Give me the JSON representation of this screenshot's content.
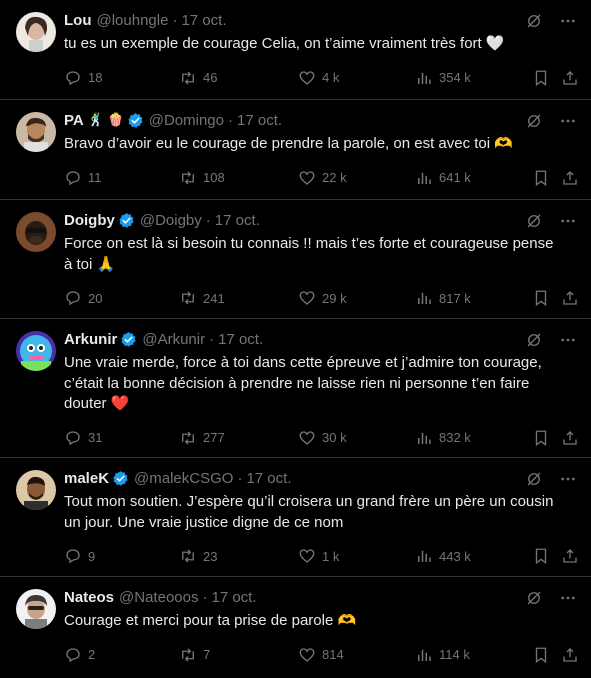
{
  "colors": {
    "background": "#000000",
    "text": "#e7e9ea",
    "muted": "#71767b",
    "verified": "#1d9bf0",
    "divider": "#2f3336"
  },
  "tweets": [
    {
      "name": "Lou",
      "name_emojis": "",
      "verified": false,
      "handle": "@louhngle",
      "dot": "·",
      "date": "17 oct.",
      "text": "tu es un exemple de courage Celia, on t’aime vraiment très fort 🤍",
      "replies": "18",
      "retweets": "46",
      "likes": "4 k",
      "views": "354 k",
      "avatar_color": "#c7b8ad"
    },
    {
      "name": "PA",
      "name_emojis": "🕺 🍿",
      "verified": true,
      "handle": "@Domingo",
      "dot": "·",
      "date": "17 oct.",
      "text": "Bravo d’avoir eu le courage de prendre la parole, on est avec toi 🫶",
      "replies": "11",
      "retweets": "108",
      "likes": "22 k",
      "views": "641 k",
      "avatar_color": "#8a6b4d"
    },
    {
      "name": "Doigby",
      "name_emojis": "",
      "verified": true,
      "handle": "@Doigby",
      "dot": "·",
      "date": "17 oct.",
      "text": "Force on est là si besoin tu connais !!  mais t’es forte et courageuse pense à toi 🙏",
      "replies": "20",
      "retweets": "241",
      "likes": "29 k",
      "views": "817 k",
      "avatar_color": "#5a3a2a"
    },
    {
      "name": "Arkunir",
      "name_emojis": "",
      "verified": true,
      "handle": "@Arkunir",
      "dot": "·",
      "date": "17 oct.",
      "text": "Une vraie merde, force à toi dans cette épreuve et j’admire ton courage, c’était la bonne décision à prendre ne laisse rien ni personne t’en faire douter ❤️",
      "replies": "31",
      "retweets": "277",
      "likes": "30 k",
      "views": "832 k",
      "avatar_color": "#6f4fd8"
    },
    {
      "name": "maleK",
      "name_emojis": "",
      "verified": true,
      "handle": "@malekCSGO",
      "dot": "·",
      "date": "17 oct.",
      "text": "Tout mon soutien. J’espère qu’il croisera un grand frère un père un cousin un jour. Une vraie justice digne de ce nom",
      "replies": "9",
      "retweets": "23",
      "likes": "1 k",
      "views": "443 k",
      "avatar_color": "#c79a5a"
    },
    {
      "name": "Nateos",
      "name_emojis": "",
      "verified": false,
      "handle": "@Nateooos",
      "dot": "·",
      "date": "17 oct.",
      "text": "Courage et merci pour ta prise de parole 🫶",
      "replies": "2",
      "retweets": "7",
      "likes": "814",
      "views": "114 k",
      "avatar_color": "#e8e8e8"
    }
  ]
}
